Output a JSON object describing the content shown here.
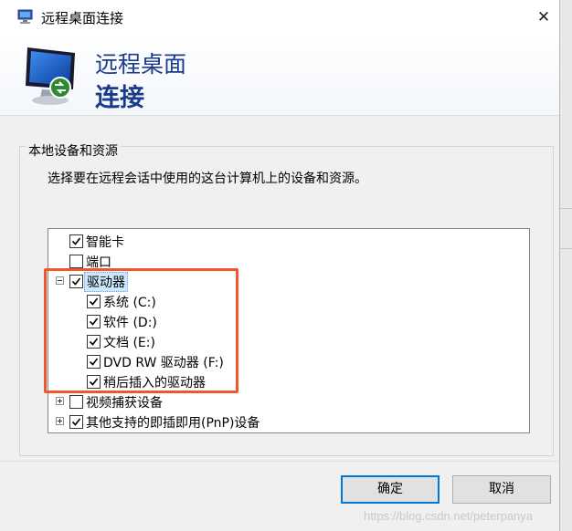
{
  "window": {
    "title": "远程桌面连接",
    "close_glyph": "✕"
  },
  "header": {
    "line1": "远程桌面",
    "line2": "连接"
  },
  "group": {
    "legend": "本地设备和资源",
    "description": "选择要在远程会话中使用的这台计算机上的设备和资源。"
  },
  "tree": {
    "items": [
      {
        "label": "智能卡",
        "checked": true
      },
      {
        "label": "端口",
        "checked": false
      },
      {
        "label": "驱动器",
        "checked": true,
        "expanded": true,
        "selected": true
      },
      {
        "label": "系统 (C:)",
        "checked": true
      },
      {
        "label": "软件 (D:)",
        "checked": true
      },
      {
        "label": "文档 (E:)",
        "checked": true
      },
      {
        "label": "DVD RW 驱动器 (F:)",
        "checked": true
      },
      {
        "label": "稍后插入的驱动器",
        "checked": true
      },
      {
        "label": "视频捕获设备",
        "checked": false,
        "expanded": false
      },
      {
        "label": "其他支持的即插即用(PnP)设备",
        "checked": true,
        "expanded": false
      }
    ]
  },
  "buttons": {
    "ok": "确定",
    "cancel": "取消"
  },
  "watermark": "https://blog.csdn.net/peterpanya",
  "colors": {
    "accent": "#0078d7",
    "highlight": "#f0552c",
    "header_text": "#1a3a8c"
  }
}
